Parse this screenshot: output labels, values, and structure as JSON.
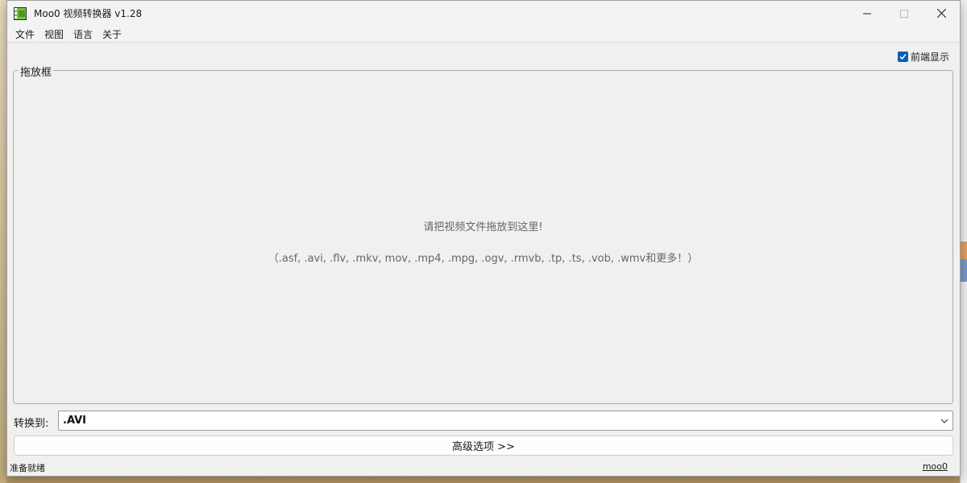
{
  "window": {
    "title": "Moo0 视频转换器 v1.28"
  },
  "menu": {
    "items": [
      "文件",
      "视图",
      "语言",
      "关于"
    ]
  },
  "options": {
    "always_on_top_label": "前端显示",
    "always_on_top_checked": true
  },
  "dropzone": {
    "legend": "拖放框",
    "hint": "请把视频文件拖放到这里!",
    "formats": "（.asf, .avi, .flv, .mkv, mov, .mp4, .mpg, .ogv, .rmvb, .tp, .ts, .vob, .wmv和更多！）"
  },
  "convert": {
    "label": "转换到:",
    "selected": ".AVI"
  },
  "advanced": {
    "label": "高级选项 >>"
  },
  "status": {
    "text": "准备就绪",
    "link": "moo0"
  },
  "colors": {
    "accent": "#0a5fb4",
    "window_bg": "#f0f0f0"
  }
}
